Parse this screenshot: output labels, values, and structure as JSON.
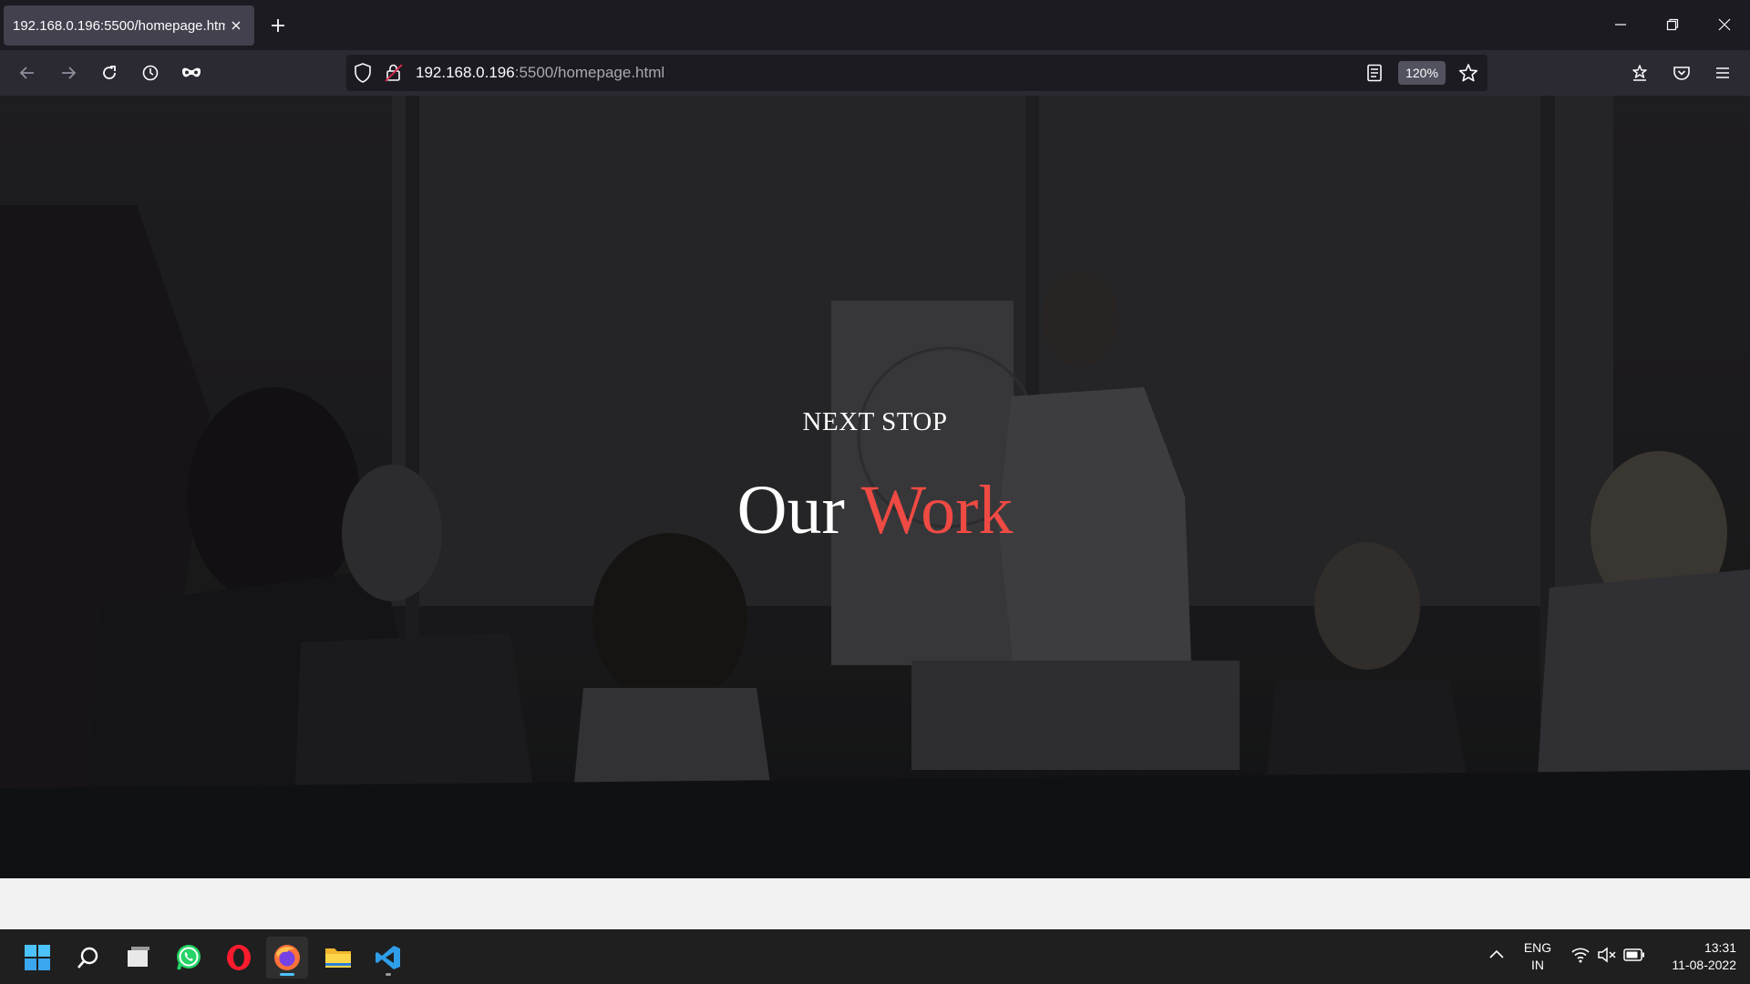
{
  "browser": {
    "tab_title": "192.168.0.196:5500/homepage.html",
    "url_host": "192.168.0.196",
    "url_path": ":5500/homepage.html",
    "zoom": "120%"
  },
  "hero": {
    "subtitle": "NEXT STOP",
    "title_main": "Our",
    "title_accent": "Work",
    "accent_color": "#ef4a43"
  },
  "taskbar": {
    "apps": [
      "start-icon",
      "search-icon",
      "task-view-icon",
      "whatsapp-icon",
      "opera-icon",
      "firefox-icon",
      "file-explorer-icon",
      "vscode-icon"
    ],
    "language_line1": "ENG",
    "language_line2": "IN",
    "time": "13:31",
    "date": "11-08-2022"
  }
}
